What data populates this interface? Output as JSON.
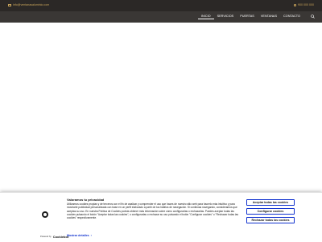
{
  "colors": {
    "topbar": "#2b2826",
    "navbar": "#3a3735",
    "accent": "#c8a45a",
    "link": "#1032cf"
  },
  "topbar": {
    "email": "info@ventanasaluminio.com",
    "phone": "900 000 000"
  },
  "nav": {
    "items": [
      "INICIO",
      "SERVICIOS",
      "PUERTAS",
      "VENTANAS",
      "CONTACTO"
    ],
    "active_index": 0
  },
  "cookie": {
    "title": "Valoramos tu privacidad",
    "text": "Utilizamos cookies propias y de terceros con el fin de analizar y comprender el uso que haces de nuestro sitio web para hacerlo más intuitivo y para mostrarte publicidad personalizada con base en un perfil elaborado a partir de tus hábitos de navegación. Si continúas navegando, consideramos que aceptas su uso. En nuestra Política de Cookies podrás obtener más información sobre cómo configurarlas o rechazarlas. Puedes aceptar todas las cookies pulsando el botón \"Aceptar todas las cookies\", o configurarlas o rechazar su uso pulsando el botón \"Configurar cookies\" o \"Rechazar todas las cookies\" respectivamente.",
    "powered_by": "Powered by",
    "brand": "Cookiebot",
    "brand_sub": "by Usercentrics",
    "details_label": "Mostrar detalles",
    "accept_label": "Aceptar todas las cookies",
    "configure_label": "Configurar cookies",
    "reject_label": "Rechazar todas las cookies"
  }
}
